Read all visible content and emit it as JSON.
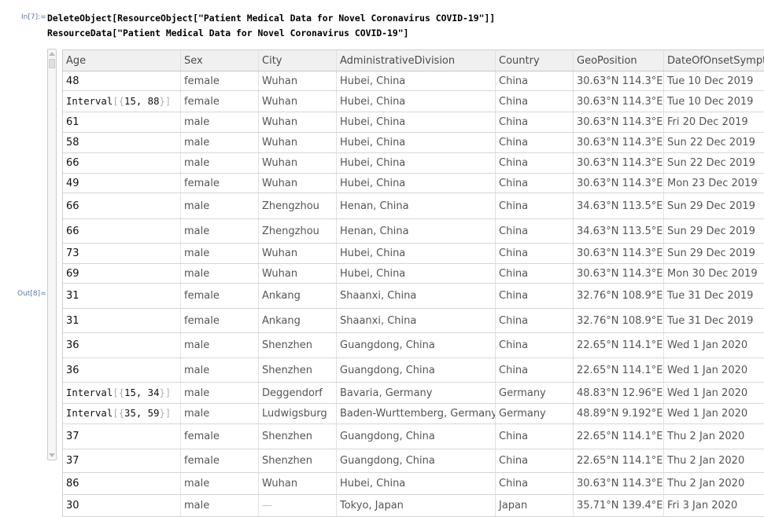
{
  "notebook": {
    "input_label": "In[7]:=",
    "output_label": "Out[8]=",
    "code_line_1": "DeleteObject[ResourceObject[\"Patient Medical Data for Novel Coronavirus COVID-19\"]]",
    "code_line_2": "ResourceData[\"Patient Medical Data for Novel Coronavirus COVID-19\"]"
  },
  "table": {
    "headers": [
      "Age",
      "Sex",
      "City",
      "AdministrativeDivision",
      "Country",
      "GeoPosition",
      "DateOfOnsetSympto"
    ],
    "rows": [
      {
        "age": "48",
        "sex": "female",
        "city": "Wuhan",
        "division": "Hubei, China",
        "country": "China",
        "geo": "30.63°N 114.3°E",
        "date": "Tue 10 Dec 2019"
      },
      {
        "age_interval": {
          "fn": "Interval",
          "open": "[{",
          "vals": "15, 88",
          "close": "}]"
        },
        "sex": "female",
        "city": "Wuhan",
        "division": "Hubei, China",
        "country": "China",
        "geo": "30.63°N 114.3°E",
        "date": "Tue 10 Dec 2019"
      },
      {
        "age": "61",
        "sex": "male",
        "city": "Wuhan",
        "division": "Hubei, China",
        "country": "China",
        "geo": "30.63°N 114.3°E",
        "date": "Fri 20 Dec 2019"
      },
      {
        "age": "58",
        "sex": "male",
        "city": "Wuhan",
        "division": "Hubei, China",
        "country": "China",
        "geo": "30.63°N 114.3°E",
        "date": "Sun 22 Dec 2019"
      },
      {
        "age": "66",
        "sex": "male",
        "city": "Wuhan",
        "division": "Hubei, China",
        "country": "China",
        "geo": "30.63°N 114.3°E",
        "date": "Sun 22 Dec 2019"
      },
      {
        "age": "49",
        "sex": "female",
        "city": "Wuhan",
        "division": "Hubei, China",
        "country": "China",
        "geo": "30.63°N 114.3°E",
        "date": "Mon 23 Dec 2019"
      },
      {
        "age": "66",
        "sex": "male",
        "city": "Zhengzhou",
        "division": "Henan, China",
        "country": "China",
        "geo": "34.63°N 113.5°E",
        "date": "Sun 29 Dec 2019"
      },
      {
        "age": "66",
        "sex": "male",
        "city": "Zhengzhou",
        "division": "Henan, China",
        "country": "China",
        "geo": "34.63°N 113.5°E",
        "date": "Sun 29 Dec 2019"
      },
      {
        "age": "73",
        "sex": "male",
        "city": "Wuhan",
        "division": "Hubei, China",
        "country": "China",
        "geo": "30.63°N 114.3°E",
        "date": "Sun 29 Dec 2019"
      },
      {
        "age": "69",
        "sex": "male",
        "city": "Wuhan",
        "division": "Hubei, China",
        "country": "China",
        "geo": "30.63°N 114.3°E",
        "date": "Mon 30 Dec 2019"
      },
      {
        "age": "31",
        "sex": "female",
        "city": "Ankang",
        "division": "Shaanxi, China",
        "country": "China",
        "geo": "32.76°N 108.9°E",
        "date": "Tue 31 Dec 2019"
      },
      {
        "age": "31",
        "sex": "female",
        "city": "Ankang",
        "division": "Shaanxi, China",
        "country": "China",
        "geo": "32.76°N 108.9°E",
        "date": "Tue 31 Dec 2019"
      },
      {
        "age": "36",
        "sex": "male",
        "city": "Shenzhen",
        "division": "Guangdong, China",
        "country": "China",
        "geo": "22.65°N 114.1°E",
        "date": "Wed 1 Jan 2020"
      },
      {
        "age": "36",
        "sex": "male",
        "city": "Shenzhen",
        "division": "Guangdong, China",
        "country": "China",
        "geo": "22.65°N 114.1°E",
        "date": "Wed 1 Jan 2020"
      },
      {
        "age_interval": {
          "fn": "Interval",
          "open": "[{",
          "vals": "15, 34",
          "close": "}]"
        },
        "sex": "male",
        "city": "Deggendorf",
        "division": "Bavaria, Germany",
        "country": "Germany",
        "geo": "48.83°N 12.96°E",
        "date": "Wed 1 Jan 2020"
      },
      {
        "age_interval": {
          "fn": "Interval",
          "open": "[{",
          "vals": "35, 59",
          "close": "}]"
        },
        "sex": "male",
        "city": "Ludwigsburg",
        "division": "Baden-Wurttemberg, Germany",
        "country": "Germany",
        "geo": "48.89°N 9.192°E",
        "date": "Wed 1 Jan 2020"
      },
      {
        "age": "37",
        "sex": "female",
        "city": "Shenzhen",
        "division": "Guangdong, China",
        "country": "China",
        "geo": "22.65°N 114.1°E",
        "date": "Thu 2 Jan 2020"
      },
      {
        "age": "37",
        "sex": "female",
        "city": "Shenzhen",
        "division": "Guangdong, China",
        "country": "China",
        "geo": "22.65°N 114.1°E",
        "date": "Thu 2 Jan 2020"
      },
      {
        "age": "86",
        "sex": "male",
        "city": "Wuhan",
        "division": "Hubei, China",
        "country": "China",
        "geo": "30.63°N 114.3°E",
        "date": "Thu 2 Jan 2020"
      },
      {
        "age": "30",
        "sex": "male",
        "city": "—",
        "division": "Tokyo, Japan",
        "country": "Japan",
        "geo": "35.71°N 139.4°E",
        "date": "Fri 3 Jan 2020"
      }
    ]
  }
}
